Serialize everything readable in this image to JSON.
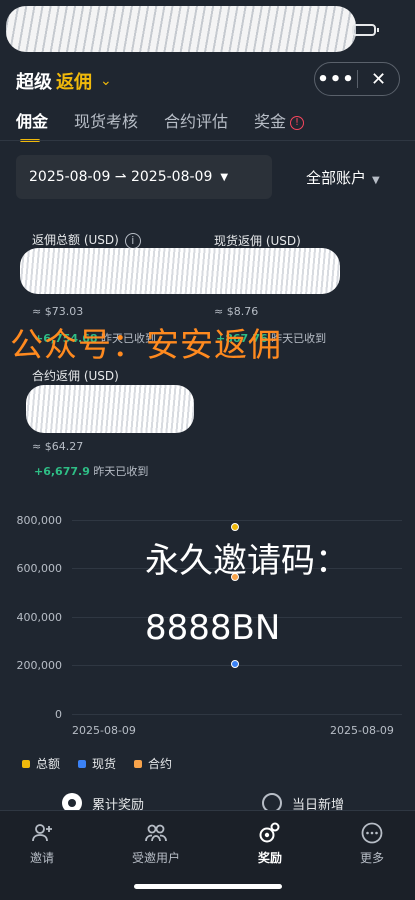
{
  "header": {
    "title_prefix": "超级",
    "title_accent": "返佣",
    "chevron": "⌄",
    "more": "•••",
    "close": "✕"
  },
  "tabs": [
    {
      "label": "佣金",
      "active": true
    },
    {
      "label": "现货考核"
    },
    {
      "label": "合约评估"
    },
    {
      "label": "奖金"
    }
  ],
  "badge": "!",
  "filter": {
    "date_range": "2025-08-09 ⇀ 2025-08-09",
    "caret": "▼",
    "account": "全部账户"
  },
  "summary": {
    "total": {
      "label": "返佣总额 (USD)",
      "info": "i",
      "approx": "≈ $73.03",
      "delta": "+6,754.68",
      "delta_note": "昨天已收到"
    },
    "spot": {
      "label": "现货返佣 (USD)",
      "approx": "≈ $8.76",
      "delta": "+867.76",
      "delta_note": "昨天已收到"
    },
    "futures": {
      "label": "合约返佣 (USD)",
      "approx": "≈ $64.27",
      "delta": "+6,677.9",
      "delta_note": "昨天已收到"
    }
  },
  "watermarks": {
    "wm1": "公众号：安安返佣",
    "wm2": "永久邀请码：",
    "wm3": "8888BN"
  },
  "chart_data": {
    "type": "scatter",
    "yticks": [
      "800,000",
      "600,000",
      "400,000",
      "200,000",
      "0"
    ],
    "ylim": [
      0,
      800000
    ],
    "x": [
      "2025-08-09"
    ],
    "xtick_labels": [
      "2025-08-09",
      "2025-08-09"
    ],
    "series": [
      {
        "name": "总额",
        "color": "#f0b90b",
        "values": [
          770000
        ]
      },
      {
        "name": "现货",
        "color": "#3b82f6",
        "values": [
          205000
        ]
      },
      {
        "name": "合约",
        "color": "#f7a34b",
        "values": [
          565000
        ]
      }
    ]
  },
  "radios": {
    "cumulative": "累计奖励",
    "daily": "当日新增"
  },
  "nav": [
    {
      "label": "邀请",
      "icon": "person-add-icon"
    },
    {
      "label": "受邀用户",
      "icon": "users-icon"
    },
    {
      "label": "奖励",
      "icon": "rewards-icon",
      "active": true
    },
    {
      "label": "更多",
      "icon": "more-icon"
    }
  ]
}
